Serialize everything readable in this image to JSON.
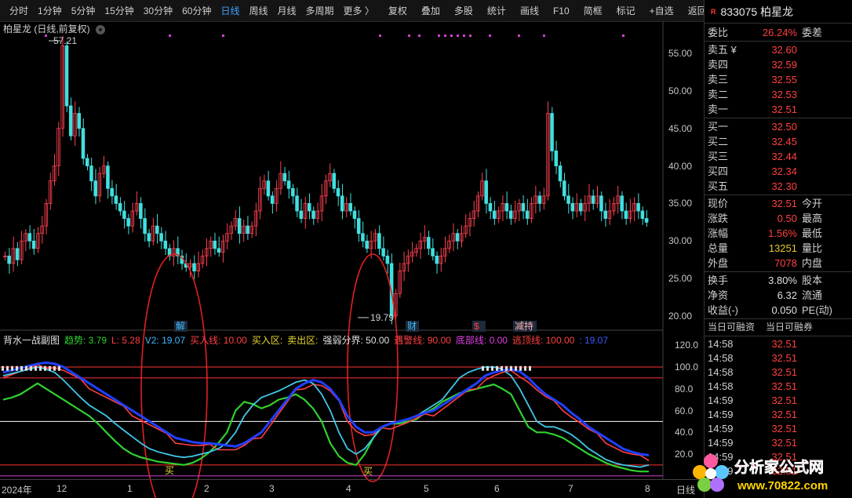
{
  "toolbar": {
    "items": [
      "分时",
      "1分钟",
      "5分钟",
      "15分钟",
      "30分钟",
      "60分钟",
      "日线",
      "周线",
      "月线",
      "多周期",
      "更多 〉"
    ],
    "active": "日线",
    "right_items": [
      "复权",
      "叠加",
      "多股",
      "统计",
      "画线",
      "F10",
      "简框",
      "标记",
      "+自选",
      "返回"
    ]
  },
  "kline": {
    "title": "柏星龙 (日线,前复权)",
    "high_label": "57.21",
    "low_label": "19.79",
    "y_ticks": [
      "55.00",
      "50.00",
      "45.00",
      "40.00",
      "35.00",
      "30.00",
      "25.00",
      "20.00"
    ]
  },
  "sub": {
    "name": "背水一战副图",
    "fields": [
      {
        "text": "趋势: 3.79",
        "color": "#30d030"
      },
      {
        "text": "L: 5.28",
        "color": "#ff4040"
      },
      {
        "text": "V2: 19.07",
        "color": "#3fb8ff"
      },
      {
        "text": "买入线: 10.00",
        "color": "#ff4040"
      },
      {
        "text": "买入区:",
        "color": "#e8d830"
      },
      {
        "text": "卖出区:",
        "color": "#e8d830"
      },
      {
        "text": "强弱分界: 50.00",
        "color": "#e0e0e0"
      },
      {
        "text": "遇警线: 90.00",
        "color": "#ff4040"
      },
      {
        "text": "底部线: 0.00",
        "color": "#e040e0"
      },
      {
        "text": "逃顶线: 100.00",
        "color": "#ff4040"
      },
      {
        "text": ": 19.07",
        "color": "#3a5cff"
      }
    ],
    "y_ticks": [
      "120.0",
      "100.0",
      "80.0",
      "60.0",
      "40.0",
      "20.0"
    ],
    "buy_marks": [
      "买",
      "买"
    ],
    "event_marks": [
      {
        "text": "解",
        "color": "#3fb8ff"
      },
      {
        "text": "财",
        "color": "#3fb8ff"
      },
      {
        "text": "$",
        "color": "#ff4040"
      },
      {
        "text": "减持",
        "color": "#ffb0b0"
      }
    ]
  },
  "xaxis": {
    "labels": [
      "2024年",
      "12",
      "1",
      "2",
      "3",
      "4",
      "5",
      "6",
      "7",
      "8",
      "日线"
    ]
  },
  "quote": {
    "name": "833075 柏星龙",
    "wb_label": "委比",
    "wb_value": "26.24%",
    "wc_label": "委差",
    "asks": [
      {
        "label": "卖五 ¥",
        "price": "32.60"
      },
      {
        "label": "卖四",
        "price": "32.59"
      },
      {
        "label": "卖三",
        "price": "32.55"
      },
      {
        "label": "卖二",
        "price": "32.53"
      },
      {
        "label": "卖一",
        "price": "32.51"
      }
    ],
    "bids": [
      {
        "label": "买一",
        "price": "32.50"
      },
      {
        "label": "买二",
        "price": "32.45"
      },
      {
        "label": "买三",
        "price": "32.44"
      },
      {
        "label": "买四",
        "price": "32.34"
      },
      {
        "label": "买五",
        "price": "32.30"
      }
    ],
    "stats": [
      {
        "l": "现价",
        "v": "32.51",
        "c": "red",
        "l2": "今开"
      },
      {
        "l": "涨跌",
        "v": "0.50",
        "c": "red",
        "l2": "最高"
      },
      {
        "l": "涨幅",
        "v": "1.56%",
        "c": "red",
        "l2": "最低"
      },
      {
        "l": "总量",
        "v": "13251",
        "c": "yel",
        "l2": "量比"
      },
      {
        "l": "外盘",
        "v": "7078",
        "c": "red",
        "l2": "内盘"
      }
    ],
    "stats2": [
      {
        "l": "换手",
        "v": "3.80%",
        "c": "wht",
        "l2": "股本"
      },
      {
        "l": "净资",
        "v": "6.32",
        "c": "wht",
        "l2": "流通"
      },
      {
        "l": "收益(-)",
        "v": "0.050",
        "c": "wht",
        "l2": "PE(动)"
      }
    ],
    "margin_labels": [
      "当日可融资",
      "当日可融券"
    ],
    "ticks": [
      {
        "t": "14:58",
        "p": "32.51"
      },
      {
        "t": "14:58",
        "p": "32.51"
      },
      {
        "t": "14:58",
        "p": "32.51"
      },
      {
        "t": "14:58",
        "p": "32.51"
      },
      {
        "t": "14:59",
        "p": "32.51"
      },
      {
        "t": "14:59",
        "p": "32.51"
      },
      {
        "t": "14:59",
        "p": "32.51"
      },
      {
        "t": "14:59",
        "p": "32.51"
      },
      {
        "t": "14:59",
        "p": "32.51"
      },
      {
        "t": "14:59",
        "p": "32.51"
      }
    ]
  },
  "watermark": {
    "line1": "分析家公式网",
    "line2": "www.70822.com"
  }
}
